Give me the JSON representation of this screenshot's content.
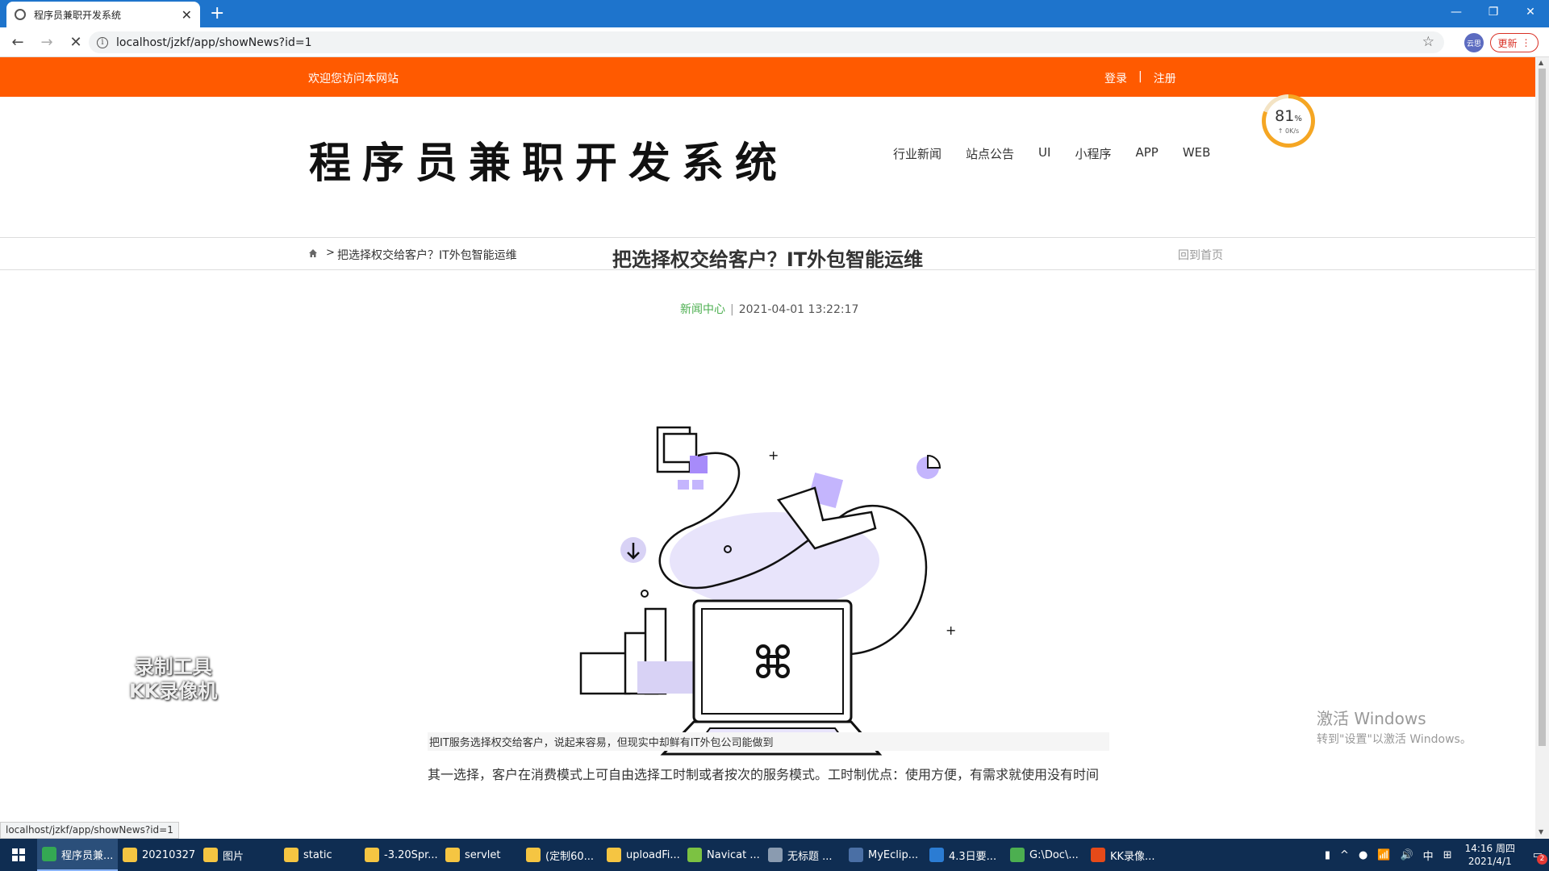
{
  "browser": {
    "tab_title": "程序员兼职开发系统",
    "url": "localhost/jzkf/app/showNews?id=1",
    "update_label": "更新",
    "profile_label": "云思"
  },
  "site": {
    "welcome": "欢迎您访问本网站",
    "login": "登录",
    "auth_sep": "|",
    "register": "注册",
    "logo_text": "程序员兼职开发系统",
    "nav": [
      "行业新闻",
      "站点公告",
      "UI",
      "小程序",
      "APP",
      "WEB"
    ]
  },
  "speed_widget": {
    "percent": "81",
    "percent_unit": "%",
    "rate": "↑ 0K/s",
    "level": 0.81
  },
  "breadcrumb": {
    "sep": ">",
    "current": "把选择权交给客户？IT外包智能运维",
    "back_home": "回到首页"
  },
  "article": {
    "title": "把选择权交给客户？IT外包智能运维",
    "category": "新闻中心",
    "meta_sep": "|",
    "date": "2021-04-01 13:22:17",
    "para1": "把IT服务选择权交给客户，说起来容易，但现实中却鲜有IT外包公司能做到",
    "para2": "其一选择，客户在消费模式上可自由选择工时制或者按次的服务模式。工时制优点：使用方便，有需求就使用没有时间"
  },
  "overlay": {
    "kk_line1": "录制工具",
    "kk_line2": "KK录像机",
    "activate_l1": "激活 Windows",
    "activate_l2": "转到\"设置\"以激活 Windows。"
  },
  "status_url": "localhost/jzkf/app/showNews?id=1",
  "taskbar": {
    "items": [
      {
        "label": "程序员兼...",
        "color": "#34a853"
      },
      {
        "label": "20210327",
        "color": "#f5c542"
      },
      {
        "label": "图片",
        "color": "#f5c542"
      },
      {
        "label": "static",
        "color": "#f5c542"
      },
      {
        "label": "-3.20Spr...",
        "color": "#f5c542"
      },
      {
        "label": "servlet",
        "color": "#f5c542"
      },
      {
        "label": "(定制60...",
        "color": "#f5c542"
      },
      {
        "label": "uploadFi...",
        "color": "#f5c542"
      },
      {
        "label": "Navicat ...",
        "color": "#7cc242"
      },
      {
        "label": "无标题 ...",
        "color": "#8a9bb0"
      },
      {
        "label": "MyEclip...",
        "color": "#4a6fa5"
      },
      {
        "label": "4.3日要...",
        "color": "#2b7cd3"
      },
      {
        "label": "G:\\Doc\\...",
        "color": "#4caf50"
      },
      {
        "label": "KK录像...",
        "color": "#e64a19"
      }
    ],
    "ime": "中",
    "time": "14:16 周四",
    "date": "2021/4/1",
    "notif_count": "2"
  }
}
